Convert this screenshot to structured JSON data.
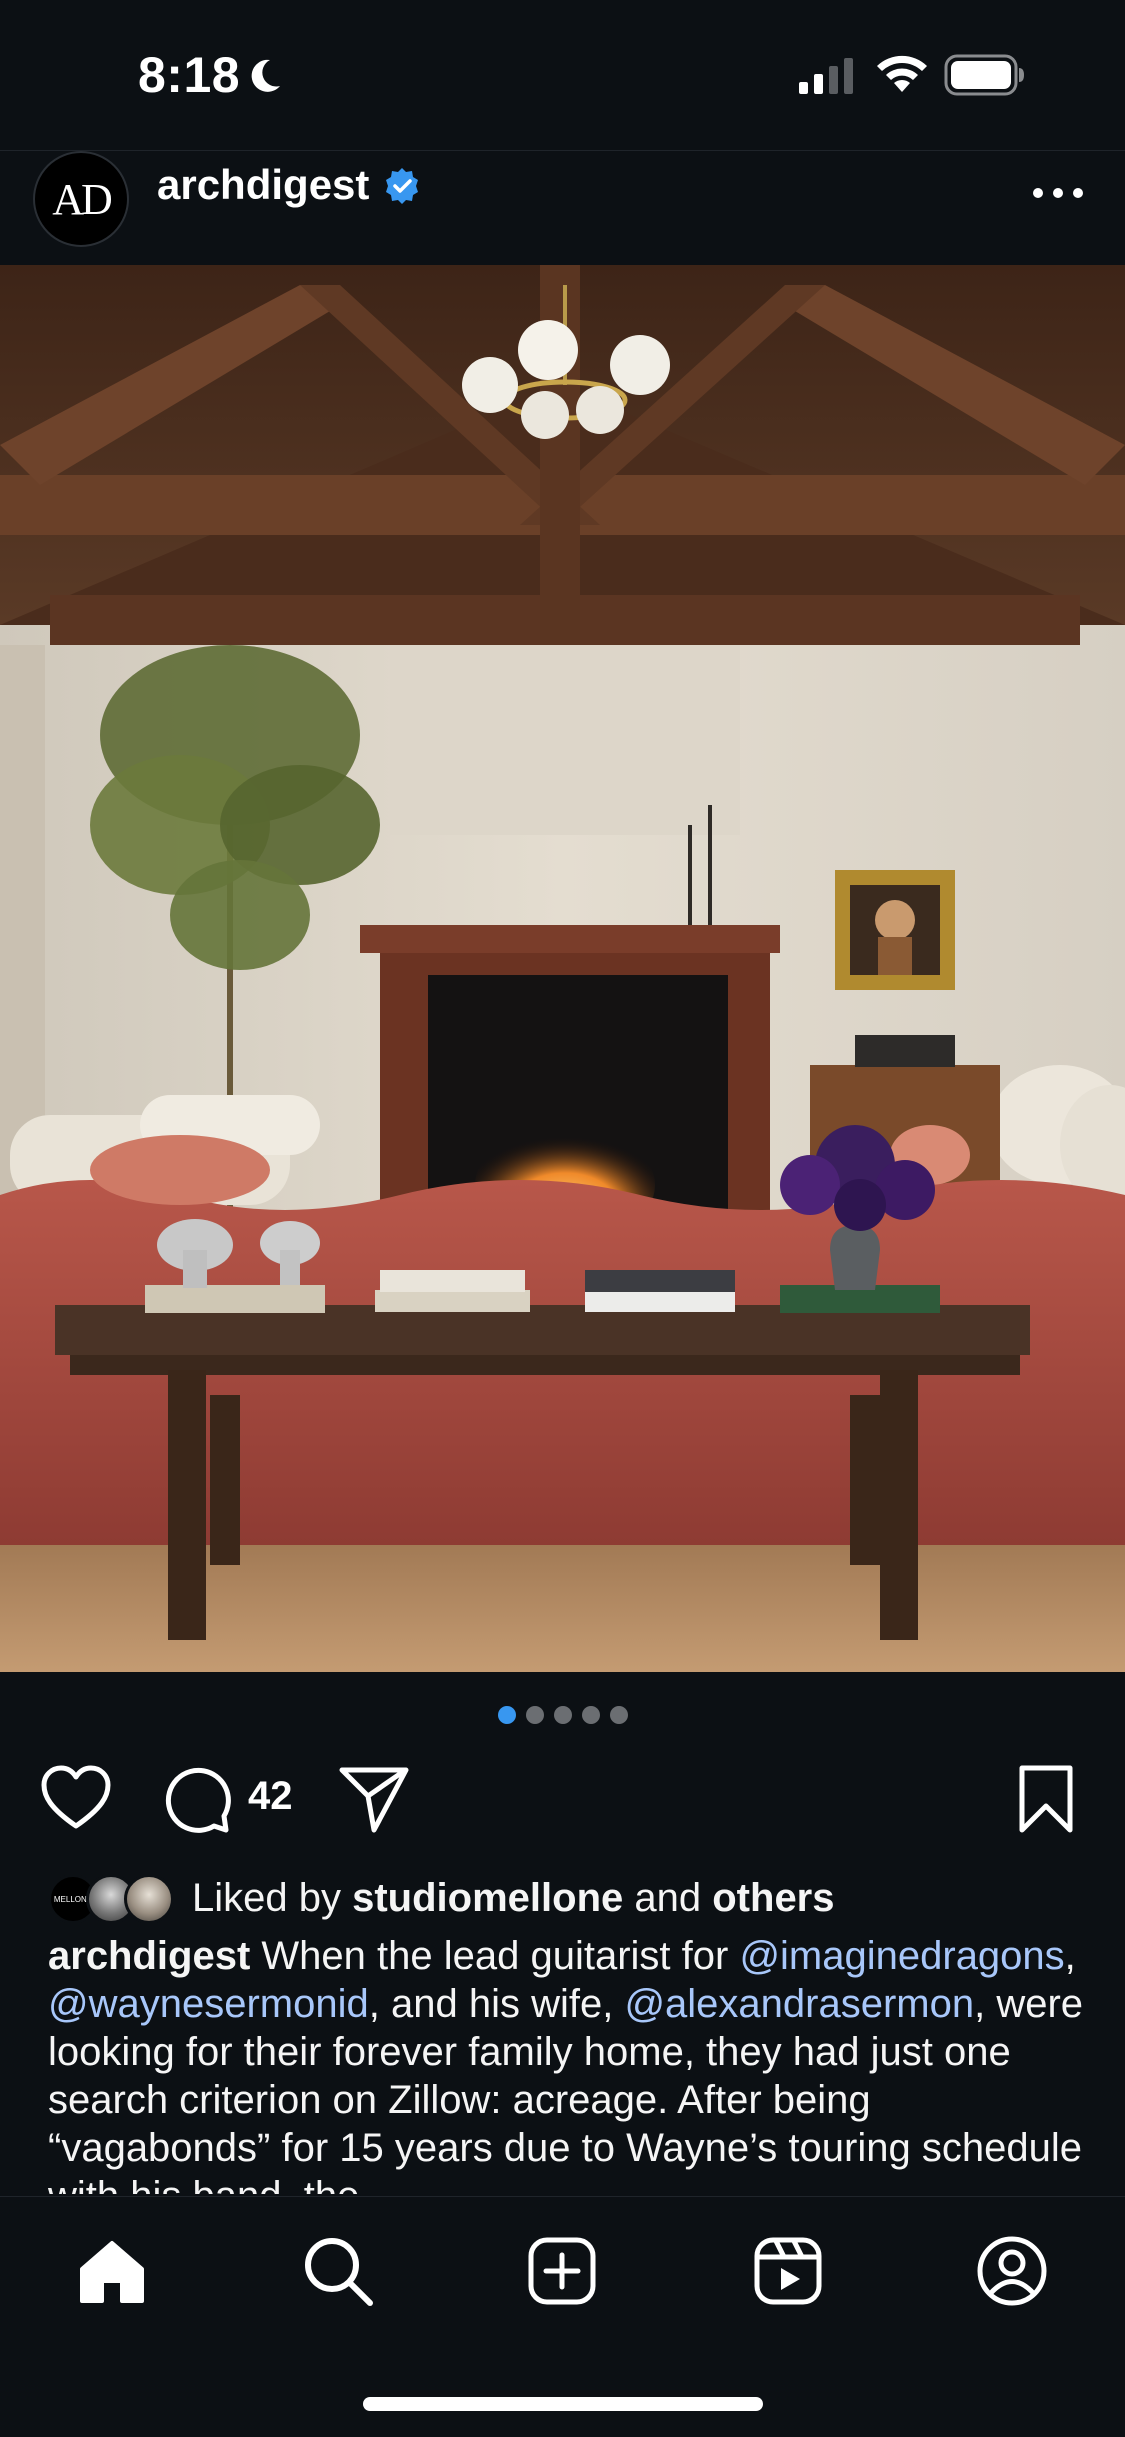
{
  "status_bar": {
    "time": "8:18",
    "moon_icon": "moon-icon",
    "signal_icon": "cellular-signal-icon",
    "wifi_icon": "wifi-icon",
    "battery_icon": "battery-icon"
  },
  "post": {
    "avatar_text": "AD",
    "username": "archdigest",
    "verified_icon": "verified-badge-icon",
    "more_icon": "more-options-icon",
    "image_icon": "living-room-photo",
    "carousel": {
      "total": 5,
      "active_index": 0
    },
    "comment_count": "42",
    "liked_by": {
      "prefix": "Liked by",
      "user": "studiomellone",
      "conjunction": "and",
      "others": "others",
      "avatar_1_text": "MELLONE"
    },
    "caption": {
      "username": "archdigest",
      "text_1": " When the lead guitarist for ",
      "mention_1": "@imaginedragons",
      "sep_1": ", ",
      "mention_2": "@waynesermonid",
      "text_2": ", and his wife, ",
      "mention_3": "@alexandrasermon",
      "text_3": ", were looking for their forever family home, they had just one search criterion on Zillow: acreage. After being “vagabonds” for 15 years due to Wayne’s touring schedule with his band, the"
    }
  },
  "colors": {
    "background": "#0c1014",
    "mention": "#a8c7fa",
    "active_dot": "#3897f0",
    "verified": "#3897f0"
  },
  "bottom_nav": [
    "home-icon",
    "search-icon",
    "create-post-icon",
    "reels-icon",
    "profile-icon"
  ]
}
